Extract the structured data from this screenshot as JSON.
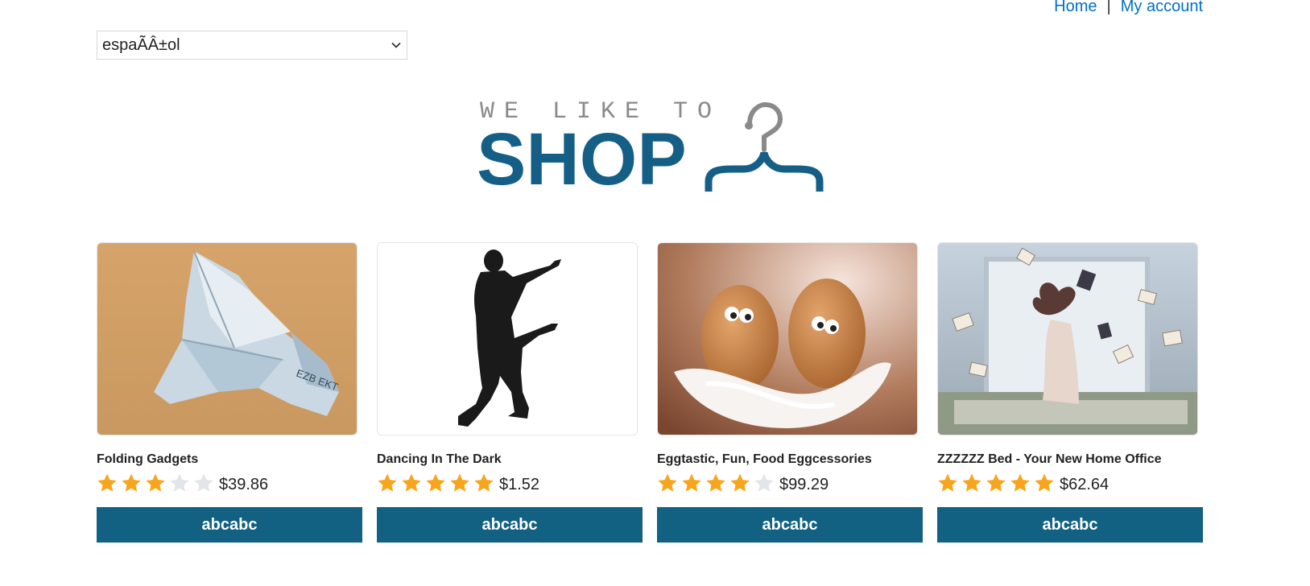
{
  "nav": {
    "home_label": "Home",
    "separator": "|",
    "account_label": "My account",
    "link_color": "#0071c1"
  },
  "language_select": {
    "value": "espaÃÂ±ol"
  },
  "logo": {
    "tagline": "WE LIKE TO",
    "wordmark": "SHOP",
    "icon": "hanger-icon",
    "colors": {
      "tagline": "#8a8a8a",
      "wordmark": "#155f87"
    }
  },
  "products": [
    {
      "title": "Folding Gadgets",
      "rating": 3,
      "rating_max": 5,
      "price": "$39.86",
      "button_label": "abcabc",
      "image": "origami-banknote-bird"
    },
    {
      "title": "Dancing In The Dark",
      "rating": 5,
      "rating_max": 5,
      "price": "$1.52",
      "button_label": "abcabc",
      "image": "dancing-silhouette"
    },
    {
      "title": "Eggtastic, Fun, Food Eggcessories",
      "rating": 4,
      "rating_max": 5,
      "price": "$99.29",
      "button_label": "abcabc",
      "image": "two-eggs-with-eyes"
    },
    {
      "title": "ZZZZZZ Bed - Your New Home Office",
      "rating": 5,
      "rating_max": 5,
      "price": "$62.64",
      "button_label": "abcabc",
      "image": "woman-on-bed-flying-books"
    }
  ],
  "colors": {
    "button_bg": "#126082",
    "star_filled": "#f7a51c",
    "star_empty": "#e2e6ea"
  }
}
